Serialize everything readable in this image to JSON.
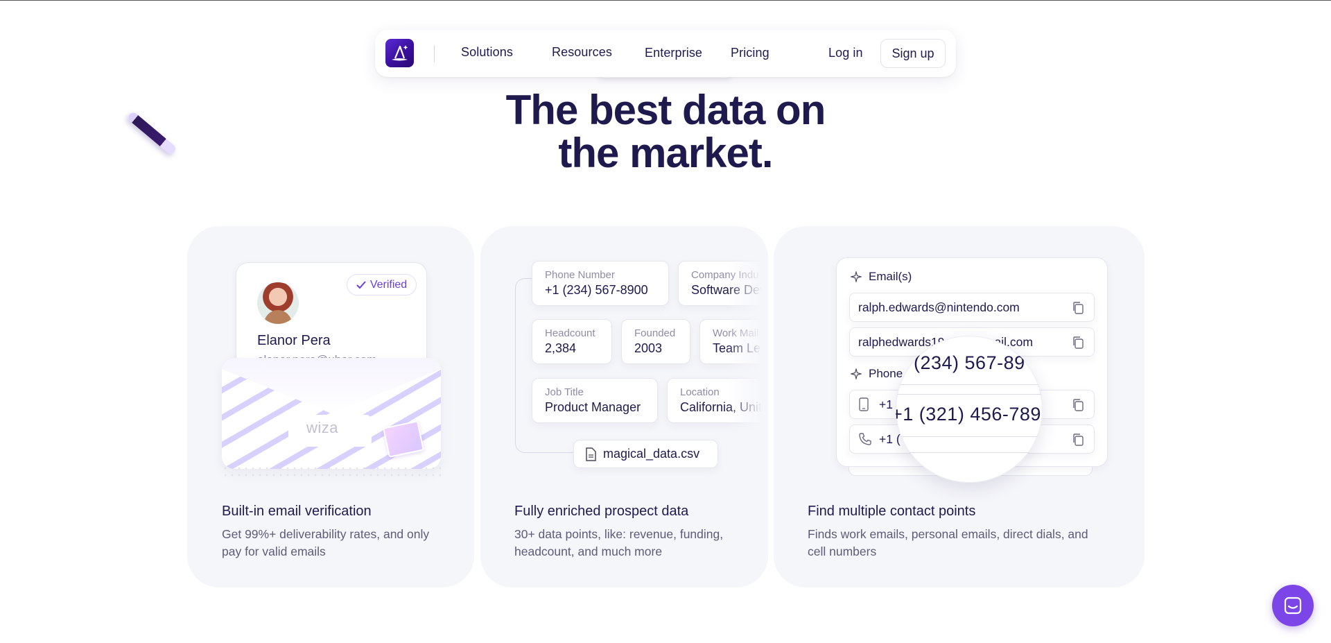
{
  "nav": {
    "items": [
      "Solutions",
      "Resources",
      "Enterprise",
      "Pricing"
    ],
    "login": "Log in",
    "signup": "Sign up"
  },
  "hero": {
    "line1": "The best data on",
    "line2": "the market."
  },
  "cards": [
    {
      "title": "Built-in email verification",
      "description": "Get 99%+ deliverability rates, and only pay for valid emails",
      "profile": {
        "badge": "Verified",
        "name": "Elanor Pera",
        "email": "elanor.pera@uber.com"
      },
      "envelope_brand": "wiza"
    },
    {
      "title": "Fully enriched prospect data",
      "description": "30+ data points, like: revenue, funding, headcount, and much more",
      "fields": [
        {
          "label": "Phone Number",
          "value": "+1 (234) 567-8900"
        },
        {
          "label": "Company Indu",
          "value": "Software Dev"
        },
        {
          "label": "Headcount",
          "value": "2,384"
        },
        {
          "label": "Founded",
          "value": "2003"
        },
        {
          "label": "Work Mail",
          "value": "Team Lea"
        },
        {
          "label": "Job Title",
          "value": "Product Manager"
        },
        {
          "label": "Location",
          "value": "California, Unit"
        }
      ],
      "file": "magical_data.csv"
    },
    {
      "title": "Find multiple contact points",
      "description": "Finds work emails, personal emails, direct dials, and cell numbers",
      "emails_label": "Email(s)",
      "emails": [
        "ralph.edwards@nintendo.com",
        "ralphedwards19"
      ],
      "email_tail": "ail.com",
      "phone_label": "Phone",
      "phones": [
        "+1",
        "+1 ("
      ],
      "magnified": [
        "(234) 567-89",
        "+1 (321) 456-789"
      ]
    }
  ],
  "colors": {
    "brand": "#5b2bd6",
    "heading": "#1e1a4d",
    "card_bg": "#f5f6fa",
    "chat": "#7b45e8"
  },
  "icons": [
    "wiza-logo-icon",
    "check-icon",
    "file-icon",
    "sparkle-icon",
    "mobile-icon",
    "phone-icon",
    "copy-icon",
    "chat-icon",
    "magic-wand-icon"
  ]
}
